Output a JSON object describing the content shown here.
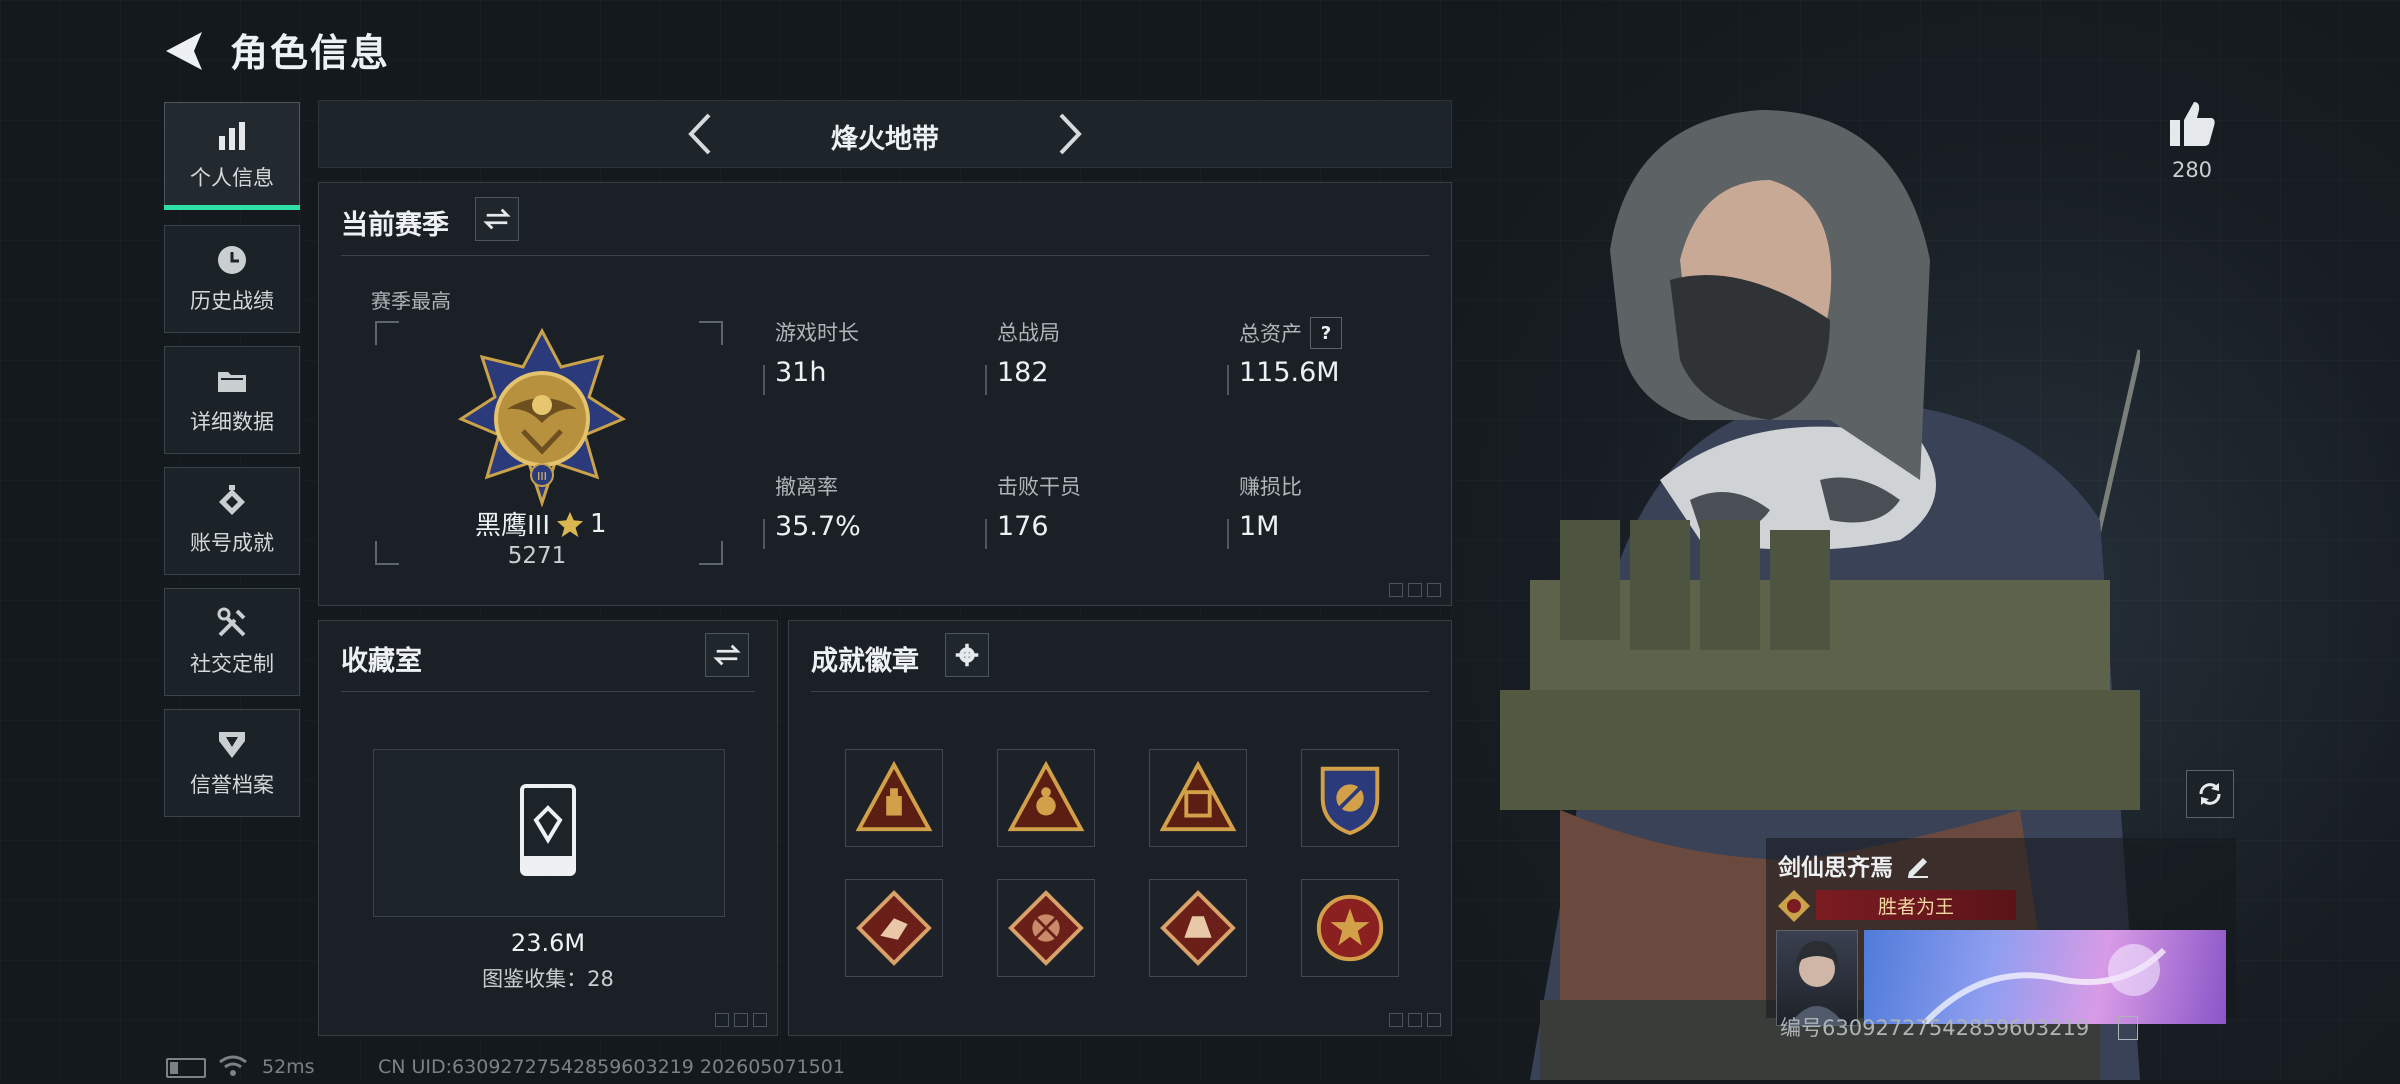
{
  "header": {
    "title": "角色信息"
  },
  "sidebar": {
    "items": [
      {
        "label": "个人信息",
        "icon": "bar-chart-icon",
        "active": true
      },
      {
        "label": "历史战绩",
        "icon": "clock-icon"
      },
      {
        "label": "详细数据",
        "icon": "folder-icon"
      },
      {
        "label": "账号成就",
        "icon": "achievement-icon"
      },
      {
        "label": "社交定制",
        "icon": "tools-icon"
      },
      {
        "label": "信誉档案",
        "icon": "shield-icon"
      }
    ]
  },
  "mode_selector": {
    "label": "烽火地带"
  },
  "season": {
    "title": "当前赛季",
    "peak_label": "赛季最高",
    "rank_name": "黑鹰III",
    "rank_stars": "1",
    "rank_score": "5271",
    "stats": [
      {
        "label": "游戏时长",
        "value": "31h"
      },
      {
        "label": "总战局",
        "value": "182"
      },
      {
        "label": "总资产",
        "value": "115.6M",
        "help": "?"
      },
      {
        "label": "撤离率",
        "value": "35.7%"
      },
      {
        "label": "击败干员",
        "value": "176"
      },
      {
        "label": "赚损比",
        "value": "1M"
      }
    ]
  },
  "collection": {
    "title": "收藏室",
    "value": "23.6M",
    "count_text": "图鉴收集：28"
  },
  "achievements": {
    "title": "成就徽章",
    "badges": [
      "triangle-badge-1",
      "triangle-badge-2",
      "triangle-badge-3",
      "crest-badge",
      "diamond-badge-1",
      "diamond-badge-2",
      "diamond-badge-3",
      "round-badge"
    ]
  },
  "player": {
    "likes": "280",
    "name": "剑仙思齐焉",
    "motto": "胜者为王",
    "id_text": "编号6309272754285960321​9"
  },
  "status_bar": {
    "ping": "52ms",
    "uid": "CN UID:63092727542859603219 202605071501"
  },
  "colors": {
    "accent": "#2fe0a5",
    "gold": "#c9a24a",
    "motto_bg": "#7a1c22"
  }
}
